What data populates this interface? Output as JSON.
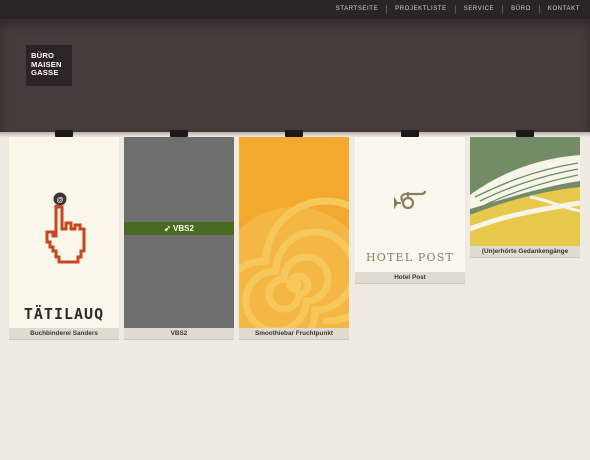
{
  "nav": {
    "items": [
      "STARTSEITE",
      "PROJEKTLISTE",
      "SERVICE",
      "BÜRO",
      "KONTAKT"
    ]
  },
  "logo": {
    "lines": [
      "BÜRO",
      "MAISEN",
      "GASSE"
    ]
  },
  "projects": [
    {
      "caption": "Buchbinderei Sanders",
      "art_text": "TÄTILAUQ",
      "art_icon": "pointing-hand-icon"
    },
    {
      "caption": "VBS2",
      "art_text": "VBS2",
      "art_icon": "vbs-arrow-icon"
    },
    {
      "caption": "Smoothiebar Fruchtpunkt",
      "art_icon": "spiral-icon"
    },
    {
      "caption": "Hotel Post",
      "art_text": "HOTEL POST",
      "art_icon": "post-horn-icon"
    },
    {
      "caption": "(Un)erhörte Gedankengänge",
      "art_icon": "wave-stripes-icon"
    }
  ],
  "colors": {
    "page_bg": "#efebe2",
    "header_bg": "#463b3d",
    "topbar_bg": "#2b2427",
    "logo_bg": "#2c2427",
    "orange_card": "#f2a92d",
    "green_band": "#4a6a22",
    "hand_red": "#c9471e"
  }
}
